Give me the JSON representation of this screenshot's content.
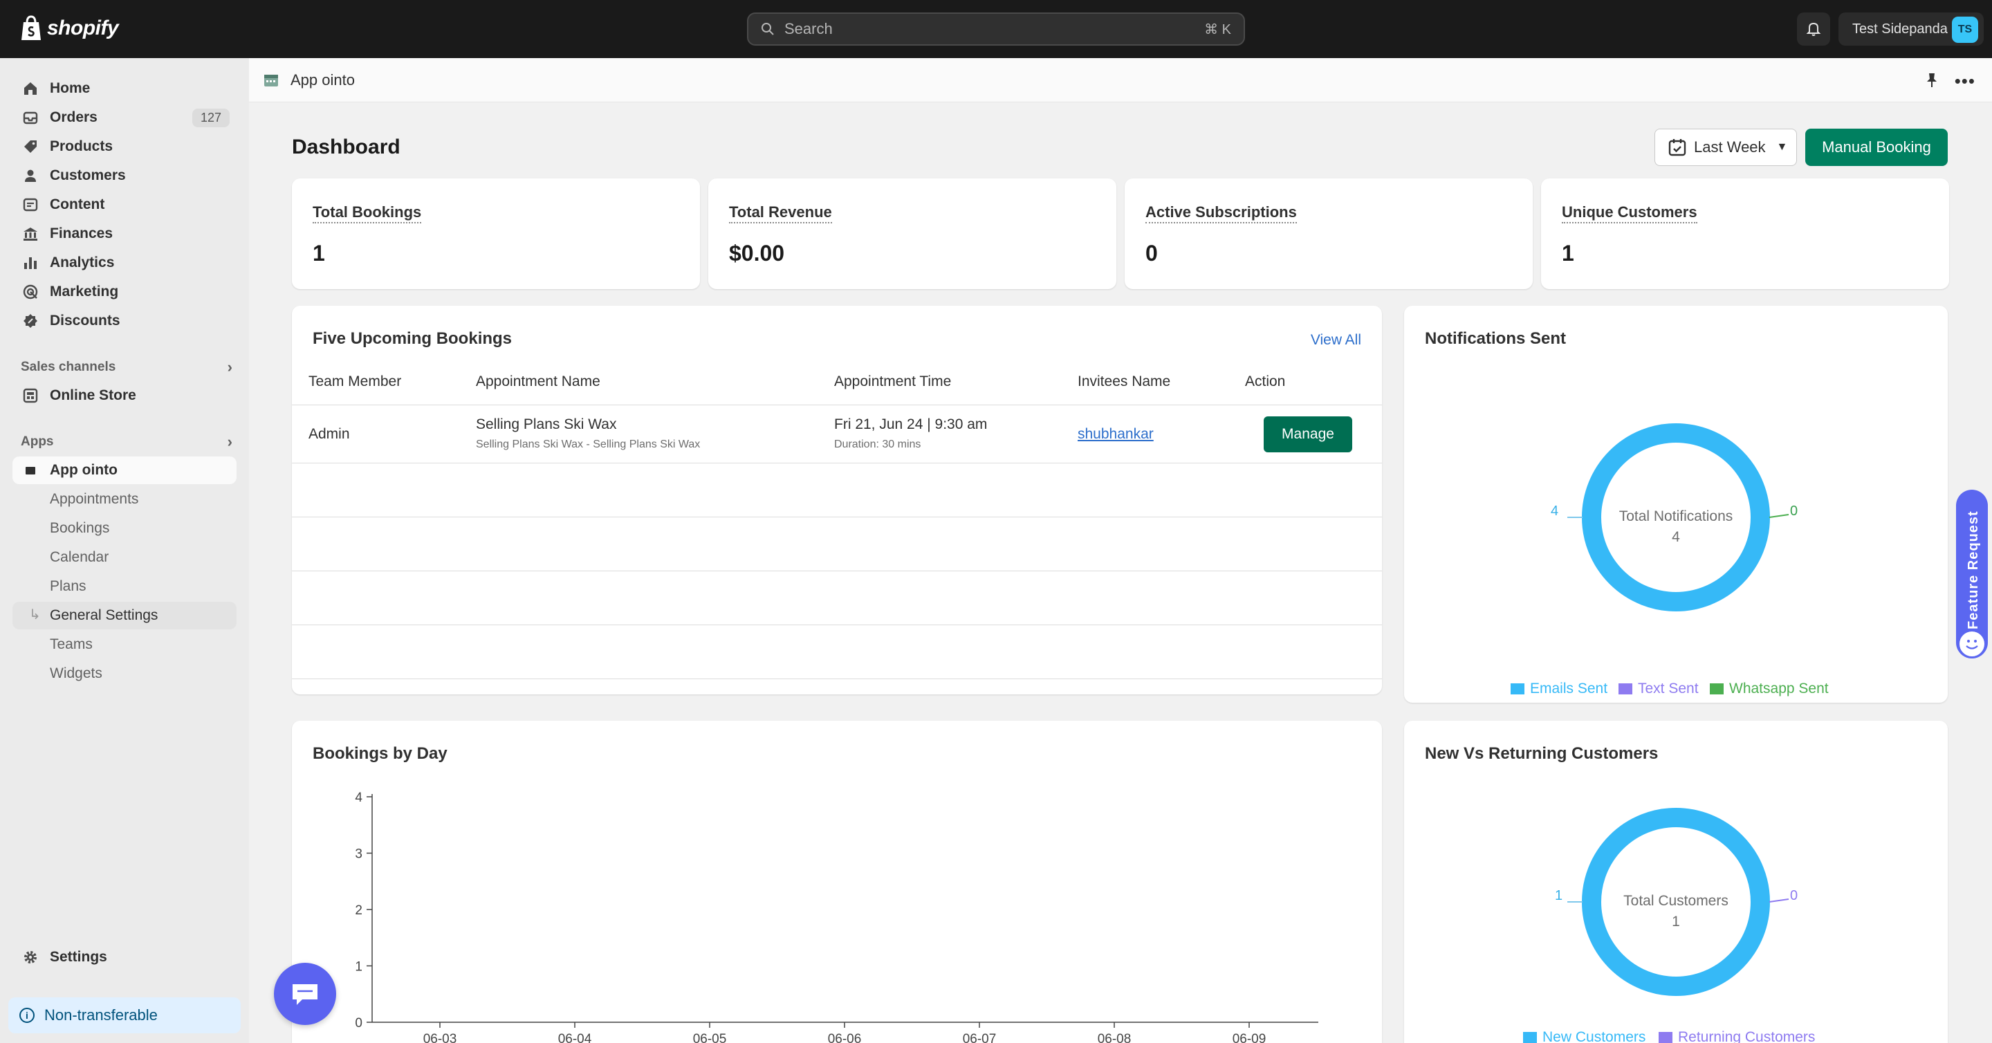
{
  "topbar": {
    "logo_text": "shopify",
    "search_placeholder": "Search",
    "search_shortcut": "⌘ K",
    "user_name": "Test Sidepanda",
    "user_initials": "TS"
  },
  "sidebar": {
    "items": [
      {
        "label": "Home",
        "icon": "home-icon"
      },
      {
        "label": "Orders",
        "icon": "orders-icon",
        "count": "127"
      },
      {
        "label": "Products",
        "icon": "tag-icon"
      },
      {
        "label": "Customers",
        "icon": "person-icon"
      },
      {
        "label": "Content",
        "icon": "content-icon"
      },
      {
        "label": "Finances",
        "icon": "bank-icon"
      },
      {
        "label": "Analytics",
        "icon": "bar-chart-icon"
      },
      {
        "label": "Marketing",
        "icon": "target-icon"
      },
      {
        "label": "Discounts",
        "icon": "discount-icon"
      }
    ],
    "sales_channels_label": "Sales channels",
    "online_store": "Online Store",
    "apps_label": "Apps",
    "app_name": "App ointo",
    "app_subitems": [
      "Appointments",
      "Bookings",
      "Calendar",
      "Plans",
      "General Settings",
      "Teams",
      "Widgets"
    ],
    "settings": "Settings",
    "non_transferable": "Non-transferable"
  },
  "app_header": {
    "title": "App ointo"
  },
  "dashboard": {
    "title": "Dashboard",
    "date_range": "Last Week",
    "manual_booking": "Manual Booking",
    "stats": [
      {
        "label": "Total Bookings",
        "value": "1"
      },
      {
        "label": "Total Revenue",
        "value": "$0.00"
      },
      {
        "label": "Active Subscriptions",
        "value": "0"
      },
      {
        "label": "Unique Customers",
        "value": "1"
      }
    ],
    "upcoming": {
      "title": "Five Upcoming Bookings",
      "view_all": "View All",
      "columns": [
        "Team Member",
        "Appointment Name",
        "Appointment Time",
        "Invitees Name",
        "Action"
      ],
      "rows": [
        {
          "team_member": "Admin",
          "appointment_name": "Selling Plans Ski Wax",
          "appointment_sub": "Selling Plans Ski Wax - Selling Plans Ski Wax",
          "time": "Fri 21, Jun 24 | 9:30 am",
          "duration": "Duration: 30 mins",
          "invitee": "shubhankar",
          "action": "Manage"
        }
      ]
    },
    "notifications": {
      "title": "Notifications Sent",
      "center_label": "Total Notifications",
      "center_value": "4",
      "left_value": "4",
      "right_value": "0",
      "legend": [
        {
          "label": "Emails Sent",
          "color": "#36b9f7"
        },
        {
          "label": "Text Sent",
          "color": "#8e7bf0"
        },
        {
          "label": "Whatsapp Sent",
          "color": "#4caf50"
        }
      ]
    },
    "bookings_by_day": {
      "title": "Bookings by Day"
    },
    "new_vs_returning": {
      "title": "New Vs Returning Customers",
      "center_label": "Total Customers",
      "center_value": "1",
      "left_value": "1",
      "right_value": "0",
      "legend": [
        {
          "label": "New Customers",
          "color": "#36b9f7"
        },
        {
          "label": "Returning Customers",
          "color": "#8e7bf0"
        }
      ]
    }
  },
  "feature_request": "Feature Request",
  "colors": {
    "brand_green": "#008060",
    "donut_blue": "#36b9f7",
    "link_blue": "#2c6ecb"
  },
  "chart_data": [
    {
      "type": "bar",
      "categories": [
        "06-03",
        "06-04",
        "06-05",
        "06-06",
        "06-07",
        "06-08",
        "06-09"
      ],
      "values": [
        0,
        0,
        0,
        0,
        0,
        0,
        0
      ],
      "title": "Bookings by Day",
      "ylim": [
        0,
        4
      ],
      "yticks": [
        0,
        1,
        2,
        3,
        4
      ]
    },
    {
      "type": "pie",
      "title": "Notifications Sent",
      "categories": [
        "Emails Sent",
        "Text Sent",
        "Whatsapp Sent"
      ],
      "values": [
        4,
        0,
        0
      ]
    },
    {
      "type": "pie",
      "title": "New Vs Returning Customers",
      "categories": [
        "New Customers",
        "Returning Customers"
      ],
      "values": [
        1,
        0
      ]
    }
  ]
}
